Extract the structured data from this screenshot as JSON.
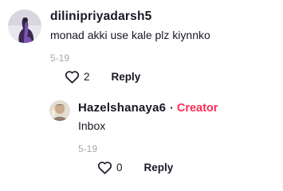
{
  "comments": [
    {
      "username": "dilinipriyadarsh5",
      "text": "monad akki use kale plz kiynnko",
      "date": "5-19",
      "likes": "2",
      "reply_label": "Reply",
      "avatar_icon": "user-avatar-purple",
      "colors": {
        "avatar_bg": "#3a2a52",
        "avatar_accent": "#8a5cc8"
      }
    },
    {
      "username": "Hazelshanaya6",
      "separator": "·",
      "badge": "Creator",
      "text": "Inbox",
      "date": "5-19",
      "likes": "0",
      "reply_label": "Reply",
      "avatar_icon": "user-avatar-photo",
      "colors": {
        "badge": "#fe2c55"
      }
    }
  ]
}
